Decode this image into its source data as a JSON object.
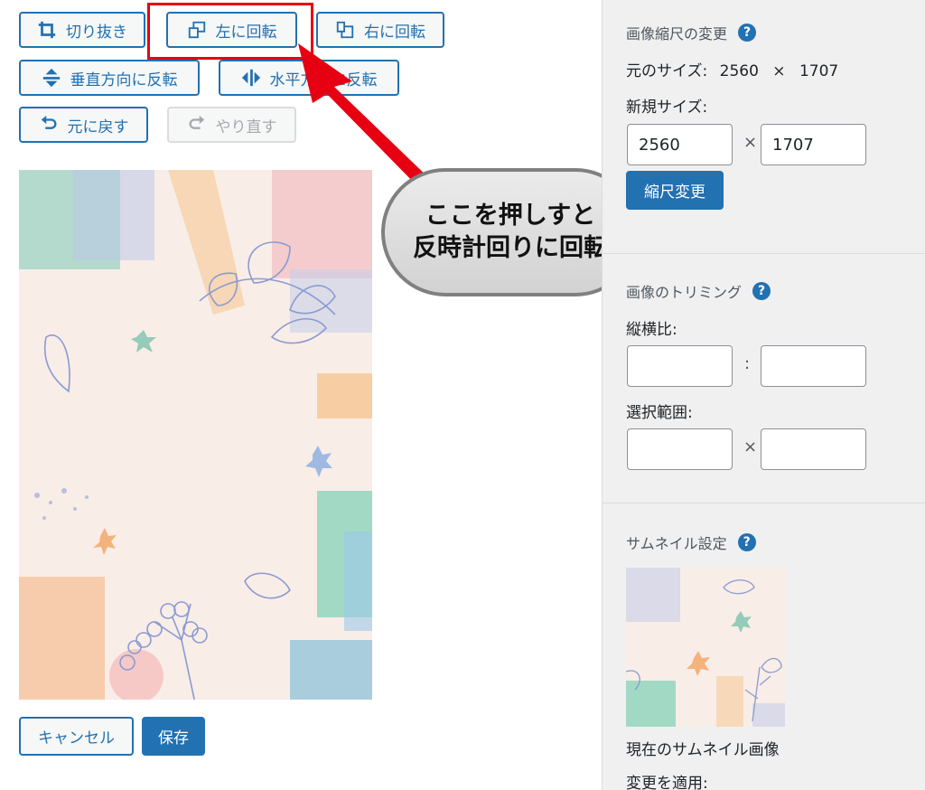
{
  "toolbar": {
    "crop": "切り抜き",
    "rotate_left": "左に回転",
    "rotate_right": "右に回転",
    "flip_vertical": "垂直方向に反転",
    "flip_horizontal": "水平方向に反転",
    "undo": "元に戻す",
    "redo": "やり直す"
  },
  "footer": {
    "cancel": "キャンセル",
    "save": "保存"
  },
  "annotation": {
    "line1": "ここを押しすと",
    "line2": "反時計回りに回転"
  },
  "scale": {
    "title": "画像縮尺の変更",
    "original_label": "元のサイズ:",
    "original_width": "2560",
    "times": "×",
    "original_height": "1707",
    "new_size_label": "新規サイズ:",
    "new_width": "2560",
    "new_height": "1707",
    "apply_button": "縮尺変更"
  },
  "crop": {
    "title": "画像のトリミング",
    "aspect_label": "縦横比:",
    "aspect_sep": ":",
    "selection_label": "選択範囲:",
    "selection_sep": "×"
  },
  "thumbnail": {
    "title": "サムネイル設定",
    "caption": "現在のサムネイル画像",
    "apply_label": "変更を適用:"
  },
  "help_icon_glyph": "?",
  "colors": {
    "accent": "#2271b1",
    "highlight": "#e60012"
  }
}
